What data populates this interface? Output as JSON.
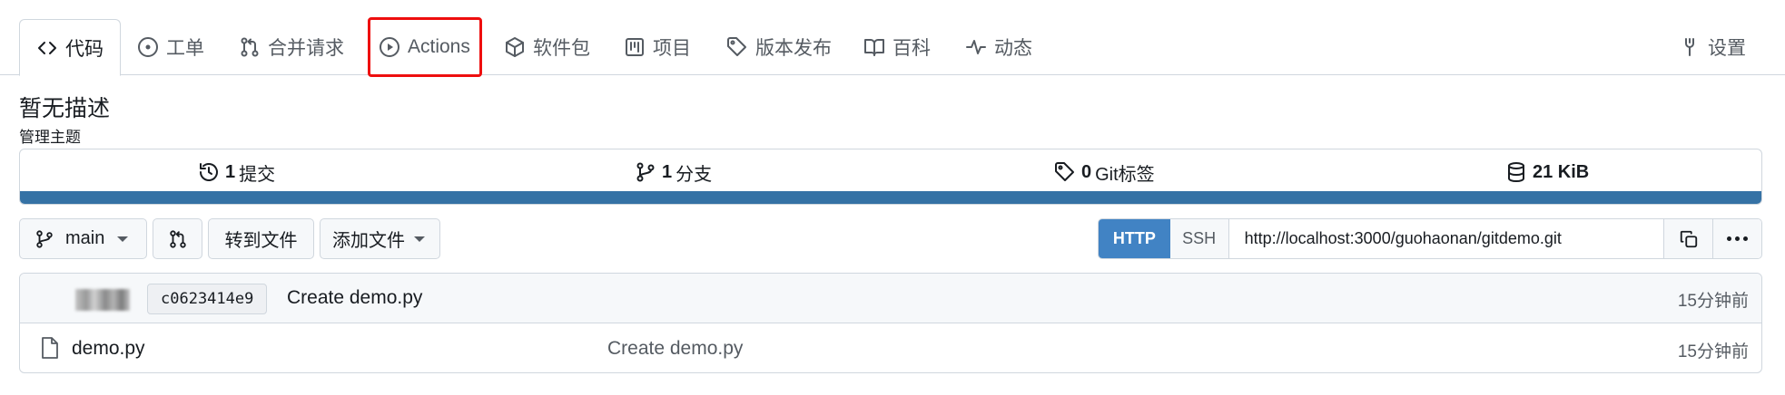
{
  "tabs": [
    {
      "label": "代码",
      "icon": "code-icon"
    },
    {
      "label": "工单",
      "icon": "issue-icon"
    },
    {
      "label": "合并请求",
      "icon": "pull-request-icon"
    },
    {
      "label": "Actions",
      "icon": "play-icon"
    },
    {
      "label": "软件包",
      "icon": "package-icon"
    },
    {
      "label": "项目",
      "icon": "project-board-icon"
    },
    {
      "label": "版本发布",
      "icon": "tag-icon"
    },
    {
      "label": "百科",
      "icon": "book-icon"
    },
    {
      "label": "动态",
      "icon": "pulse-icon"
    }
  ],
  "settings": {
    "label": "设置",
    "icon": "tools-icon"
  },
  "repo": {
    "description": "暂无描述",
    "manage_topics": "管理主题"
  },
  "stats": {
    "commits": {
      "count": "1",
      "label": "提交",
      "icon": "history-icon"
    },
    "branches": {
      "count": "1",
      "label": "分支",
      "icon": "branch-icon"
    },
    "tags": {
      "count": "0",
      "label": "Git标签",
      "icon": "tag-icon"
    },
    "size": {
      "value": "21 KiB",
      "icon": "database-icon"
    },
    "language_bar_color": "#3572A5"
  },
  "toolbar": {
    "branch": "main",
    "goto_file": "转到文件",
    "add_file": "添加文件",
    "clone": {
      "http": "HTTP",
      "ssh": "SSH",
      "url": "http://localhost:3000/guohaonan/gitdemo.git"
    }
  },
  "latest_commit": {
    "sha": "c0623414e9",
    "message": "Create demo.py",
    "time": "15分钟前"
  },
  "files": [
    {
      "name": "demo.py",
      "commit": "Create demo.py",
      "time": "15分钟前",
      "icon": "file-icon"
    }
  ],
  "colors": {
    "accent": "#4183c4",
    "highlight": "#ee0e0e"
  }
}
